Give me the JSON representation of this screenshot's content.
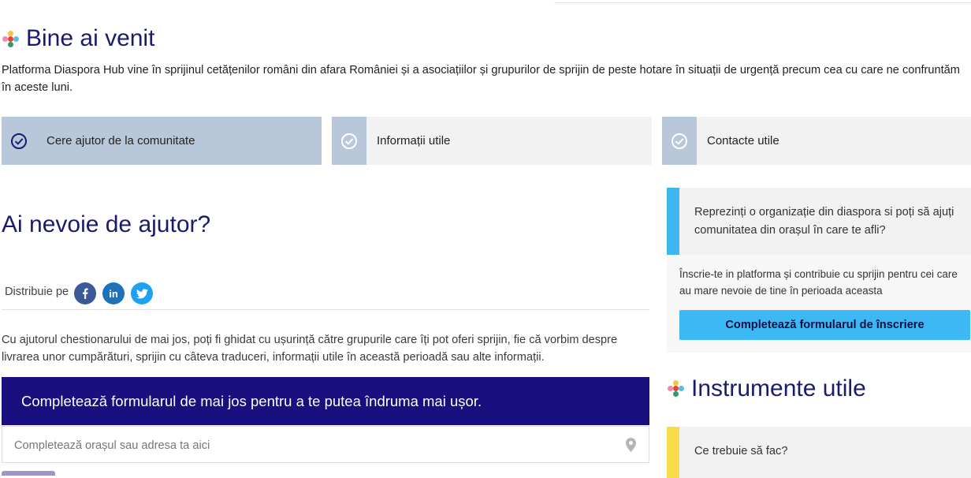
{
  "welcome": {
    "title": "Bine ai venit",
    "intro": "Platforma Diaspora Hub vine în sprijinul cetățenilor români din afara României și a asociațiilor și grupurilor de sprijin de peste hotare în situații de urgență precum cea cu care ne confruntăm în aceste luni."
  },
  "tabs": [
    {
      "label": "Cere ajutor de la comunitate",
      "active": true
    },
    {
      "label": "Informații utile",
      "active": false
    },
    {
      "label": "Contacte utile",
      "active": false
    }
  ],
  "help": {
    "title": "Ai nevoie de ajutor?",
    "share_label": "Distribuie pe",
    "share_icons": [
      "facebook-icon",
      "linkedin-icon",
      "twitter-icon"
    ],
    "description": "Cu ajutorul chestionarului de mai jos, poți fi ghidat cu ușurință către grupurile care îți pot oferi sprijin, fie că vorbim despre livrarea unor cumpărături, sprijin cu câteva traduceri, informații utile în această perioadă sau alte informații.",
    "banner": "Completează formularul de mai jos pentru a te putea îndruma mai ușor.",
    "address_placeholder": "Completează orașul sau adresa ta aici",
    "address_value": ""
  },
  "sidebar": {
    "org_question": "Reprezinți o organizație din diaspora si poți să ajuți comunitatea din orașul în care te afli?",
    "org_text": "Înscrie-te in platforma și contribuie cu sprijin pentru cei care au mare nevoie de tine în perioada aceasta",
    "org_button": "Completează formularul de înscriere",
    "tools_title": "Instrumente utile",
    "tools_item": "Ce trebuie să fac?"
  },
  "colors": {
    "accent_navy": "#1a0f7e",
    "accent_blue": "#3cb8f5",
    "tab_active": "#b8c8da",
    "tools_yellow": "#f8dc4a"
  }
}
